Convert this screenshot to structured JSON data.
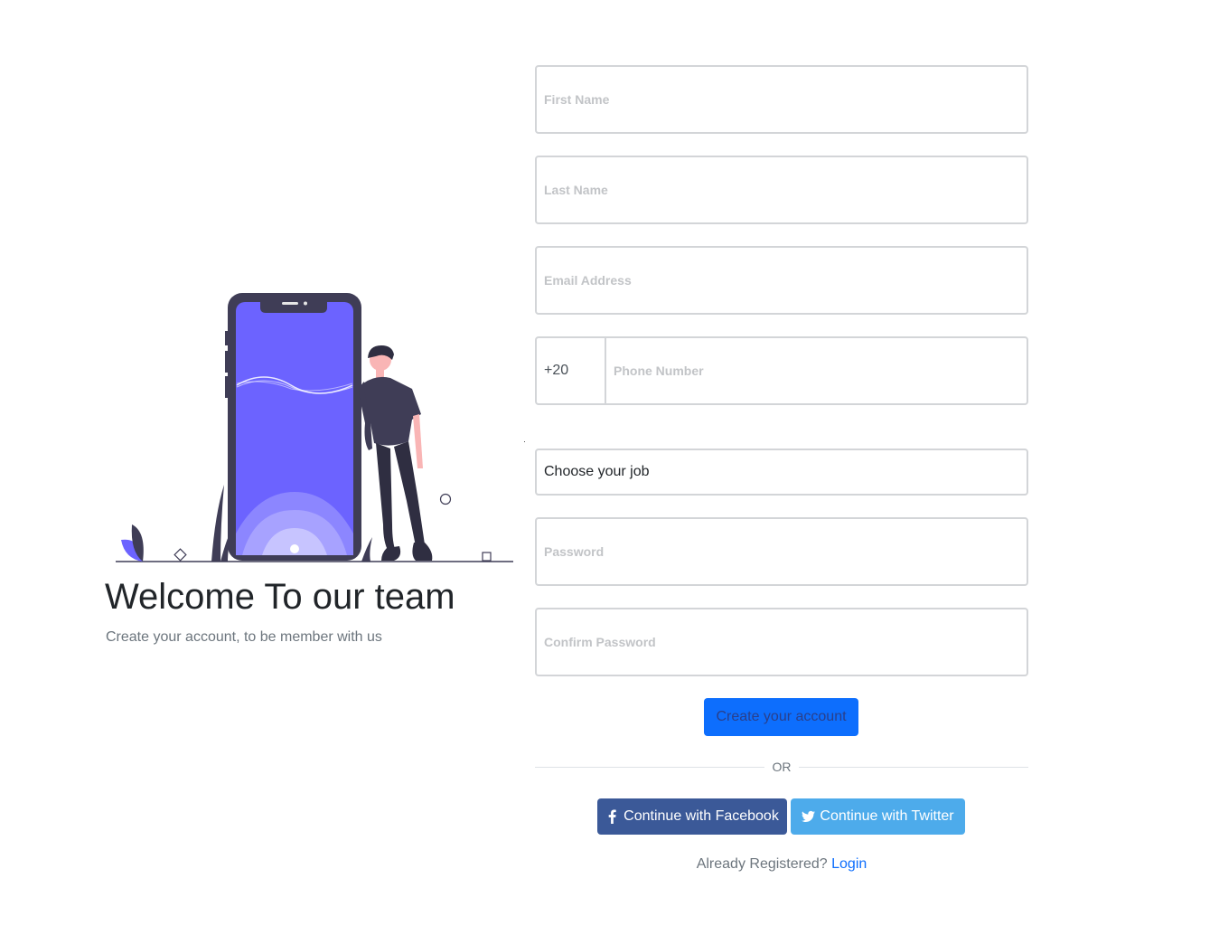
{
  "welcome": {
    "title": "Welcome To our team",
    "subtitle": "Create your account, to be member with us"
  },
  "illustration": {
    "name": "phone-with-person-illustration",
    "accent_color": "#6c63ff",
    "dark_color": "#3f3d56"
  },
  "form": {
    "first_name": {
      "placeholder": "First Name",
      "value": ""
    },
    "last_name": {
      "placeholder": "Last Name",
      "value": ""
    },
    "email": {
      "placeholder": "Email Address",
      "value": ""
    },
    "phone": {
      "country_code": "+20",
      "placeholder": "Phone Number",
      "value": ""
    },
    "job": {
      "selected": "Choose your job"
    },
    "password": {
      "placeholder": "Password",
      "value": ""
    },
    "confirm_password": {
      "placeholder": "Confirm Password",
      "value": ""
    },
    "submit_label": "Create your account",
    "divider_text": "OR"
  },
  "social": {
    "facebook": {
      "label": "Continue with Facebook",
      "icon": "facebook-icon",
      "color": "#3b5998"
    },
    "twitter": {
      "label": "Continue with Twitter",
      "icon": "twitter-icon",
      "color": "#4dabeb"
    }
  },
  "footer": {
    "prompt": "Already Registered?",
    "login_label": "Login"
  },
  "colors": {
    "primary": "#0d6efd",
    "border": "#d3d5d8",
    "muted": "#6c757d"
  }
}
